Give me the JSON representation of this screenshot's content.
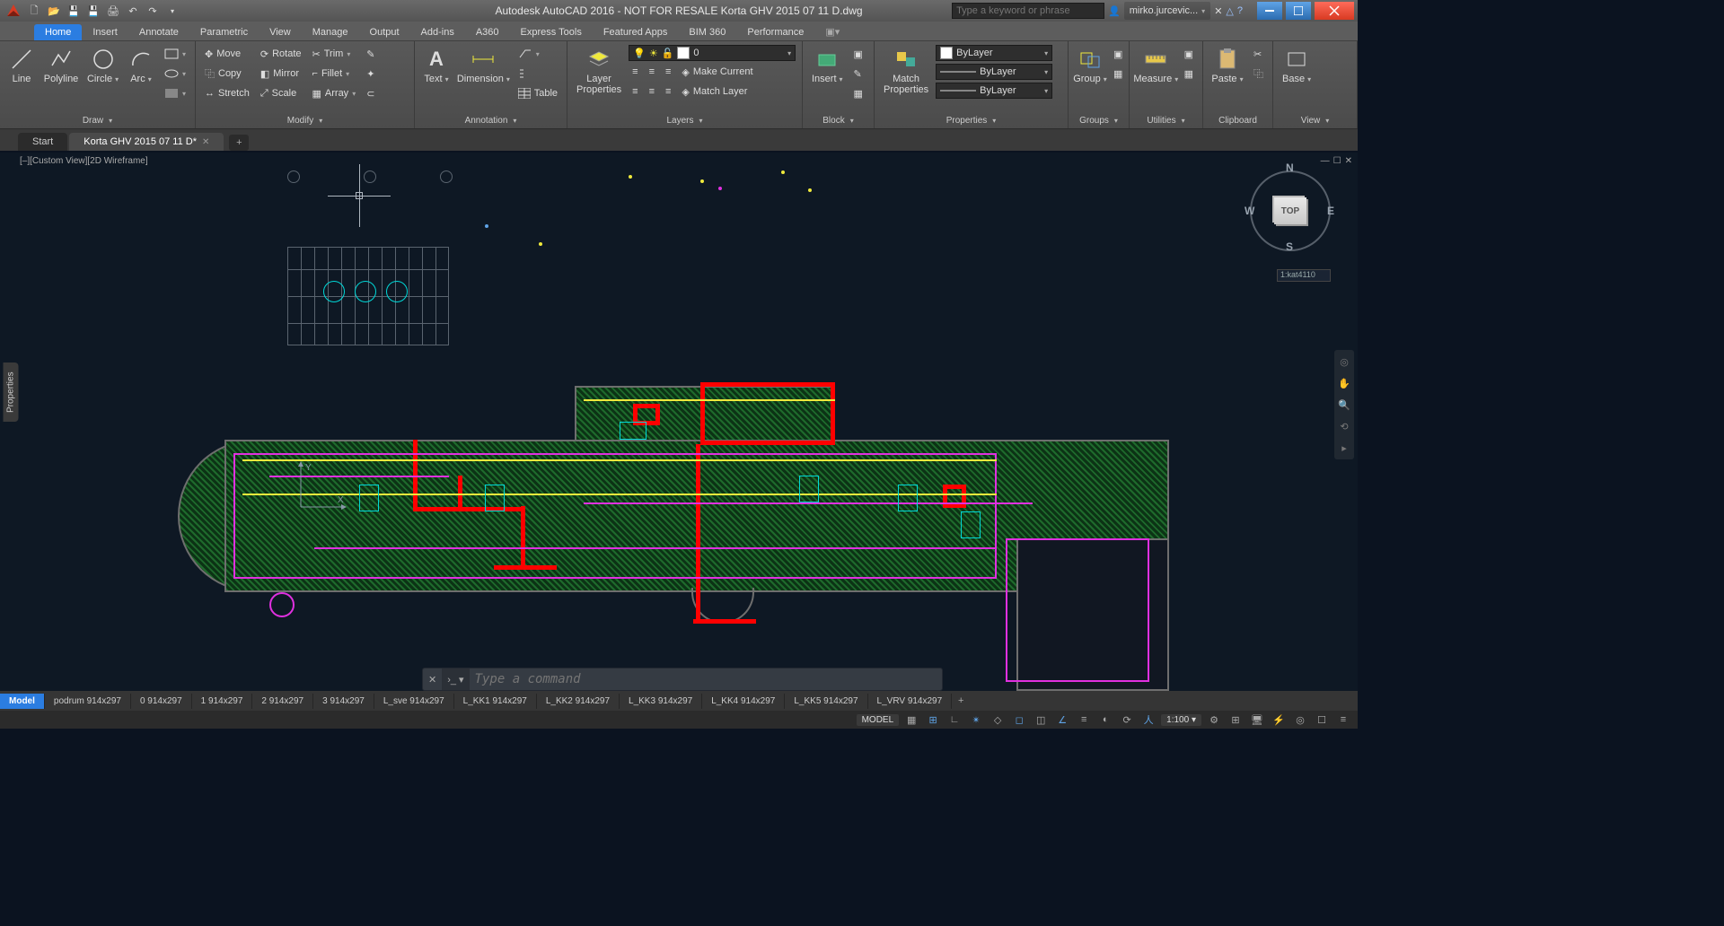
{
  "title": "Autodesk AutoCAD 2016 - NOT FOR RESALE    Korta GHV 2015 07 11 D.dwg",
  "search_placeholder": "Type a keyword or phrase",
  "user": "mirko.jurcevic...",
  "menu_tabs": [
    "Home",
    "Insert",
    "Annotate",
    "Parametric",
    "View",
    "Manage",
    "Output",
    "Add-ins",
    "A360",
    "Express Tools",
    "Featured Apps",
    "BIM 360",
    "Performance"
  ],
  "panels": {
    "draw": {
      "label": "Draw",
      "items": [
        "Line",
        "Polyline",
        "Circle",
        "Arc"
      ]
    },
    "modify": {
      "label": "Modify",
      "rows": [
        [
          "Move",
          "Rotate",
          "Trim"
        ],
        [
          "Copy",
          "Mirror",
          "Fillet"
        ],
        [
          "Stretch",
          "Scale",
          "Array"
        ]
      ]
    },
    "annotation": {
      "label": "Annotation",
      "text": "Text",
      "dim": "Dimension",
      "table": "Table"
    },
    "layers": {
      "label": "Layers",
      "btn": "Layer\nProperties",
      "layer0": "0",
      "mc": "Make Current",
      "ml": "Match Layer"
    },
    "block": {
      "label": "Block",
      "insert": "Insert"
    },
    "properties": {
      "label": "Properties",
      "match": "Match\nProperties",
      "bylayer": "ByLayer"
    },
    "groups": {
      "label": "Groups",
      "group": "Group"
    },
    "utilities": {
      "label": "Utilities",
      "measure": "Measure"
    },
    "clipboard": {
      "label": "Clipboard",
      "paste": "Paste"
    },
    "view": {
      "label": "View",
      "base": "Base"
    }
  },
  "file_tabs": {
    "start": "Start",
    "active": "Korta GHV 2015 07 11 D*"
  },
  "viewport_label": "[–][Custom View][2D Wireframe]",
  "properties_tab": "Properties",
  "viewcube": {
    "top": "TOP",
    "n": "N",
    "s": "S",
    "e": "E",
    "w": "W",
    "coord": "1:kat4110"
  },
  "ucs": {
    "x": "X",
    "y": "Y"
  },
  "cmd_placeholder": "Type a command",
  "layout_tabs": [
    "Model",
    "podrum 914x297",
    "0 914x297",
    "1 914x297",
    "2 914x297",
    "3 914x297",
    "L_sve 914x297",
    "L_KK1 914x297",
    "L_KK2 914x297",
    "L_KK3 914x297",
    "L_KK4 914x297",
    "L_KK5 914x297",
    "L_VRV 914x297"
  ],
  "status": {
    "model": "MODEL",
    "scale": "1:100"
  }
}
